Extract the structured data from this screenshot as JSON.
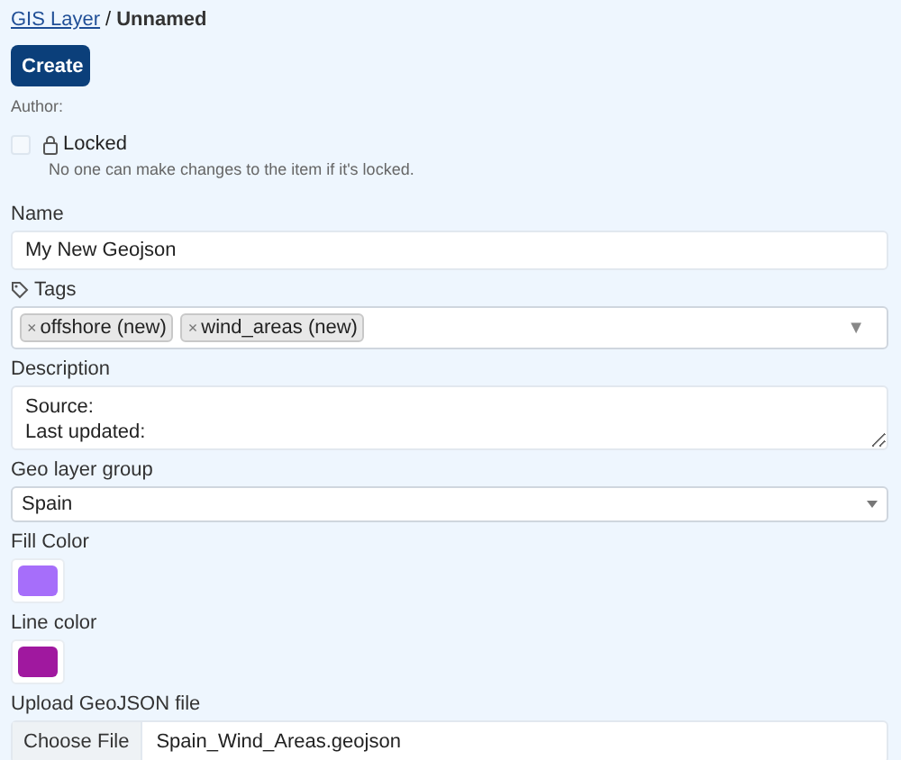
{
  "breadcrumb": {
    "link": "GIS Layer",
    "separator": "/",
    "current": "Unnamed"
  },
  "create_button": "Create",
  "author_label": "Author:",
  "locked": {
    "label": "Locked",
    "checked": false,
    "help": "No one can make changes to the item if it's locked."
  },
  "name": {
    "label": "Name",
    "value": "My New Geojson"
  },
  "tags": {
    "label": "Tags",
    "items": [
      {
        "remove": "×",
        "label": "offshore (new)"
      },
      {
        "remove": "×",
        "label": "wind_areas (new)"
      }
    ],
    "dropdown": "▼"
  },
  "description": {
    "label": "Description",
    "value": "Source:\nLast updated:"
  },
  "geo_layer_group": {
    "label": "Geo layer group",
    "value": "Spain"
  },
  "fill_color": {
    "label": "Fill Color",
    "color": "#a66efa"
  },
  "line_color": {
    "label": "Line color",
    "color": "#a0189f"
  },
  "upload": {
    "label": "Upload GeoJSON file",
    "button": "Choose File",
    "file": "Spain_Wind_Areas.geojson"
  }
}
